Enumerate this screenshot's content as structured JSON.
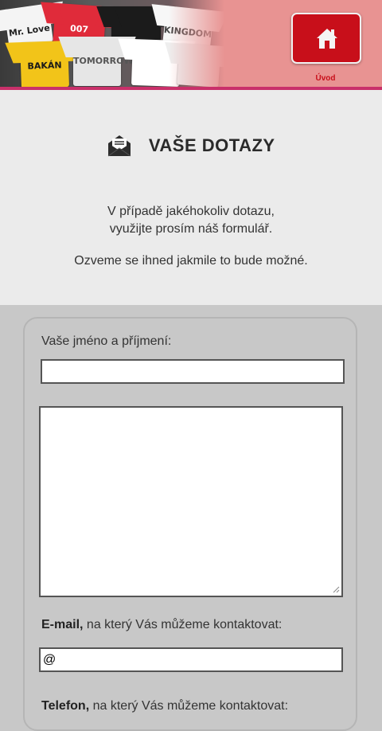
{
  "header": {
    "banner_shirts": [
      {
        "text": "Mr. Love",
        "color": "#f4f4f4",
        "ink": "#222222"
      },
      {
        "text": "007",
        "color": "#e02b3a",
        "ink": "#ffffff"
      },
      {
        "text": "",
        "color": "#1b1b1b",
        "ink": "#c9a64a"
      },
      {
        "text": "KINGDOM",
        "color": "#f7f7f7",
        "ink": "#444444"
      },
      {
        "text": "BAKÁN",
        "color": "#f2c419",
        "ink": "#1a1a1a"
      },
      {
        "text": "TOMORROW",
        "color": "#e6e6e6",
        "ink": "#555555"
      },
      {
        "text": "",
        "color": "#ffffff",
        "ink": "#d64b5b"
      },
      {
        "text": "",
        "color": "#eeeeee",
        "ink": "#999999"
      }
    ],
    "home_label": "Úvod"
  },
  "info": {
    "title": "VAŠE DOTAZY",
    "line1": "V případě jakéhokoliv dotazu,",
    "line2": "využijte prosím náš formulář.",
    "line3": "Ozveme se ihned jakmile to bude možné."
  },
  "form": {
    "name_label": "Vaše jméno a příjmení:",
    "name_value": "",
    "message_value": "",
    "email_label_bold": "E-mail,",
    "email_label_rest": " na který Vás můžeme kontaktovat:",
    "email_value": "@",
    "phone_label_bold": "Telefon,",
    "phone_label_rest": " na který Vás můžeme kontaktovat:"
  },
  "colors": {
    "brand_red": "#c80f1a",
    "header_pink": "#e89392",
    "accent_magenta": "#c9306a",
    "info_bg": "#ebebeb",
    "form_bg": "#c8c8c8"
  }
}
